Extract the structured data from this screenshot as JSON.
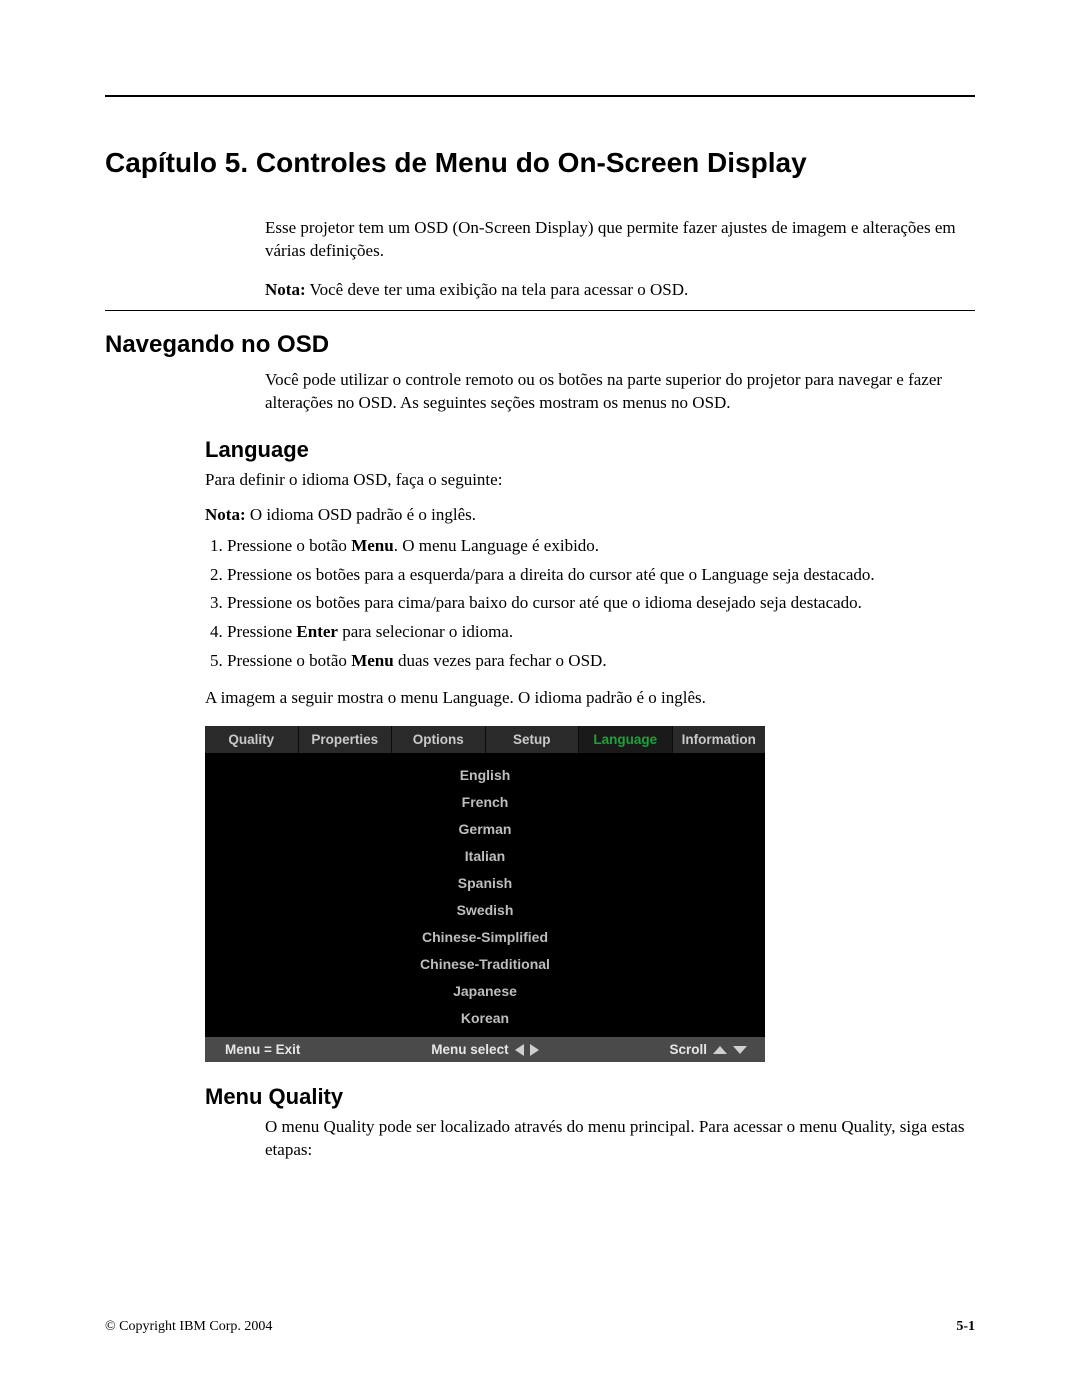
{
  "chapter_title": "Capítulo 5. Controles de Menu do On-Screen Display",
  "intro": "Esse projetor tem um OSD (On-Screen Display) que permite fazer ajustes de imagem e alterações em várias definições.",
  "nota1_label": "Nota:",
  "nota1_text": " Você deve ter uma exibição na tela para acessar o OSD.",
  "section1_title": "Navegando no OSD",
  "section1_body": "Você pode utilizar o controle remoto ou os botões na parte superior do projetor para navegar e fazer alterações no OSD. As seguintes seções mostram os menus no OSD.",
  "sub_language": "Language",
  "lang_intro": "Para definir o idioma OSD, faça o seguinte:",
  "nota2_label": "Nota:",
  "nota2_text": " O idioma OSD padrão é o inglês.",
  "steps": {
    "s1a": "Pressione o botão ",
    "s1b": "Menu",
    "s1c": ". O menu Language é exibido.",
    "s2": "Pressione os botões para a esquerda/para a direita do cursor até que o Language seja destacado.",
    "s3": "Pressione os botões para cima/para baixo do cursor até que o idioma desejado seja destacado.",
    "s4a": "Pressione ",
    "s4b": "Enter",
    "s4c": " para selecionar o idioma.",
    "s5a": "Pressione o botão ",
    "s5b": "Menu",
    "s5c": " duas vezes para fechar o OSD."
  },
  "lang_fig_caption": "A imagem a seguir mostra o menu Language. O idioma padrão é o inglês.",
  "osd": {
    "tabs": [
      "Quality",
      "Properties",
      "Options",
      "Setup",
      "Language",
      "Information"
    ],
    "active_index": 4,
    "items": [
      "English",
      "French",
      "German",
      "Italian",
      "Spanish",
      "Swedish",
      "Chinese-Simplified",
      "Chinese-Traditional",
      "Japanese",
      "Korean"
    ],
    "footer_left": "Menu = Exit",
    "footer_mid": "Menu select",
    "footer_right": "Scroll"
  },
  "sub_quality": "Menu Quality",
  "quality_body": "O menu Quality pode ser localizado através do menu principal. Para acessar o menu Quality, siga estas etapas:",
  "footer_left": "© Copyright IBM Corp. 2004",
  "footer_right": "5-1"
}
